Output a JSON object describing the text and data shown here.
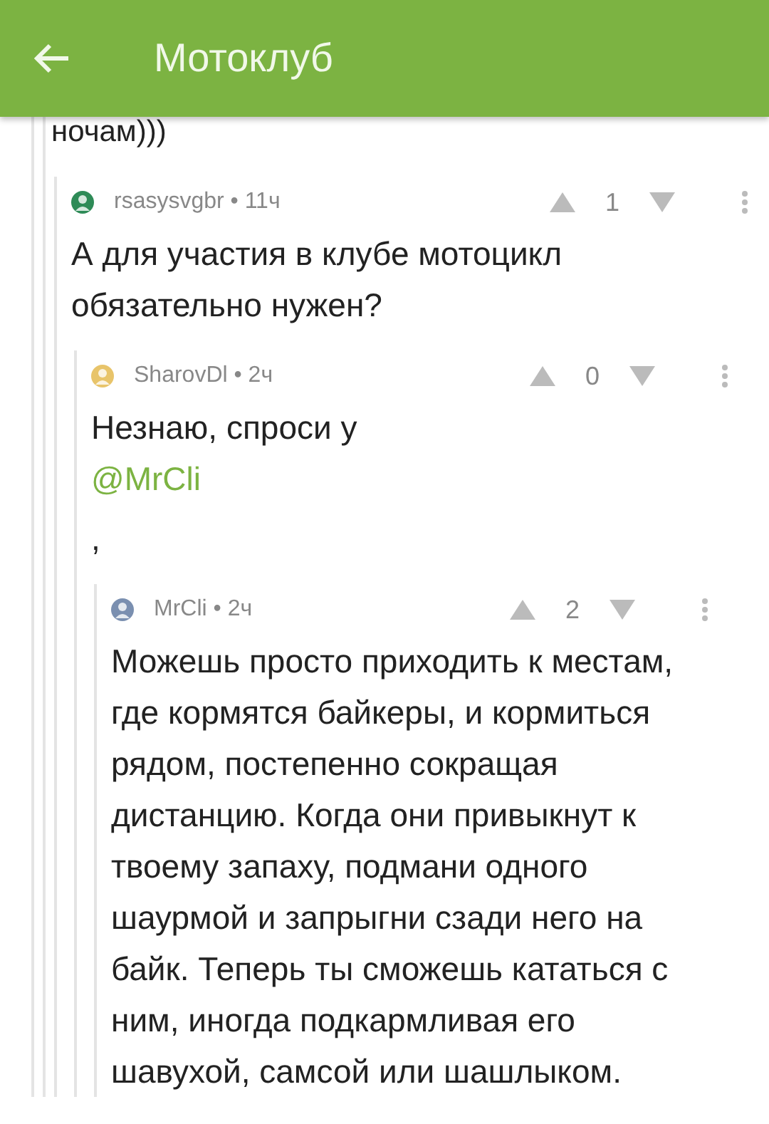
{
  "header": {
    "title": "Мотоклуб"
  },
  "fragment": "ночам)))",
  "comments": [
    {
      "byline": "rsasysvgbr • 11ч",
      "votes": "1",
      "body": [
        {
          "kind": "text",
          "text": "А для участия в клубе мотоцикл обязательно нужен?"
        }
      ],
      "children": [
        {
          "byline": "SharovDl • 2ч",
          "votes": "0",
          "body": [
            {
              "kind": "text",
              "text": "Незнаю, спроси у"
            },
            {
              "kind": "mention",
              "text": "@MrCli"
            },
            {
              "kind": "gap_text",
              "text": ","
            }
          ],
          "children": [
            {
              "byline": "MrCli • 2ч",
              "votes": "2",
              "body": [
                {
                  "kind": "text",
                  "text": "Можешь просто приходить к местам, где кормятся байкеры, и кормиться рядом, постепенно сокращая дистанцию. Когда они привыкнут к твоему запаху, подмани одного шаурмой и запрыгни сзади него на байк. Теперь ты сможешь кататься с ним, иногда подкармливая его шавухой, самсой или шашлыком."
                }
              ]
            }
          ]
        }
      ]
    }
  ]
}
